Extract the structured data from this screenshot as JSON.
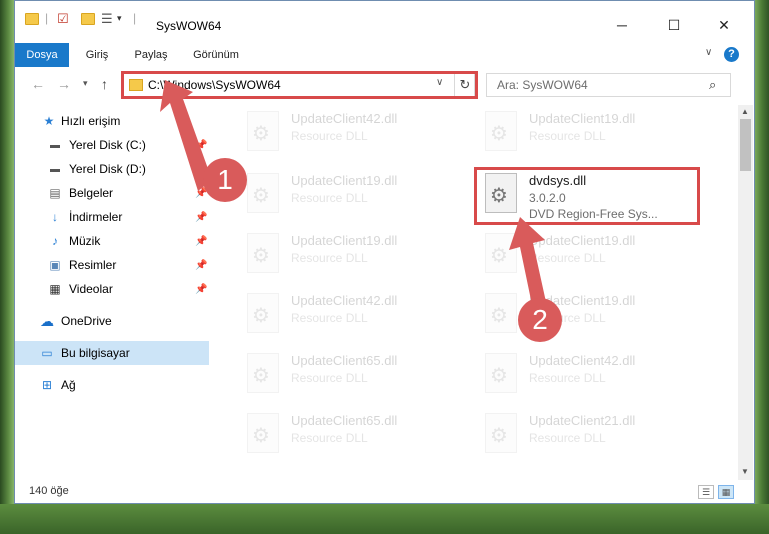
{
  "window": {
    "title": "SysWOW64"
  },
  "ribbon": {
    "tabs": [
      "Dosya",
      "Giriş",
      "Paylaş",
      "Görünüm"
    ],
    "help_label": "?"
  },
  "address": {
    "path": "C:\\Windows\\SysWOW64",
    "search_placeholder": "Ara: SysWOW64"
  },
  "sidebar": {
    "items": [
      {
        "label": "Hızlı erişim",
        "icon": "star-icon"
      },
      {
        "label": "Yerel Disk (C:)",
        "icon": "drive-icon"
      },
      {
        "label": "Yerel Disk (D:)",
        "icon": "drive-icon"
      },
      {
        "label": "Belgeler",
        "icon": "documents-icon"
      },
      {
        "label": "İndirmeler",
        "icon": "downloads-icon"
      },
      {
        "label": "Müzik",
        "icon": "music-icon"
      },
      {
        "label": "Resimler",
        "icon": "pictures-icon"
      },
      {
        "label": "Videolar",
        "icon": "videos-icon"
      },
      {
        "label": "OneDrive",
        "icon": "cloud-icon"
      },
      {
        "label": "Bu bilgisayar",
        "icon": "computer-icon"
      },
      {
        "label": "Ağ",
        "icon": "network-icon"
      }
    ]
  },
  "files": [
    {
      "name": "UpdateClient42.dll",
      "type": "Resource DLL"
    },
    {
      "name": "UpdateClient19.dll",
      "type": "Resource DLL"
    },
    {
      "name": "UpdateClient19.dll",
      "type": "Resource DLL"
    },
    {
      "name": "dvdsys.dll",
      "version": "3.0.2.0",
      "description": "DVD Region-Free Sys..."
    },
    {
      "name": "UpdateClient19.dll",
      "type": "Resource DLL"
    },
    {
      "name": "UpdateClient19.dll",
      "type": "Resource DLL"
    },
    {
      "name": "UpdateClient42.dll",
      "type": "Resource DLL"
    },
    {
      "name": "UpdateClient19.dll",
      "type": "Resource DLL"
    },
    {
      "name": "UpdateClient65.dll",
      "type": "Resource DLL"
    },
    {
      "name": "UpdateClient42.dll",
      "type": "Resource DLL"
    },
    {
      "name": "UpdateClient65.dll",
      "type": "Resource DLL"
    },
    {
      "name": "UpdateClient21.dll",
      "type": "Resource DLL"
    }
  ],
  "status": {
    "item_count": "140 öğe"
  },
  "annotations": {
    "step1": "1",
    "step2": "2",
    "color": "#d95b5b"
  }
}
